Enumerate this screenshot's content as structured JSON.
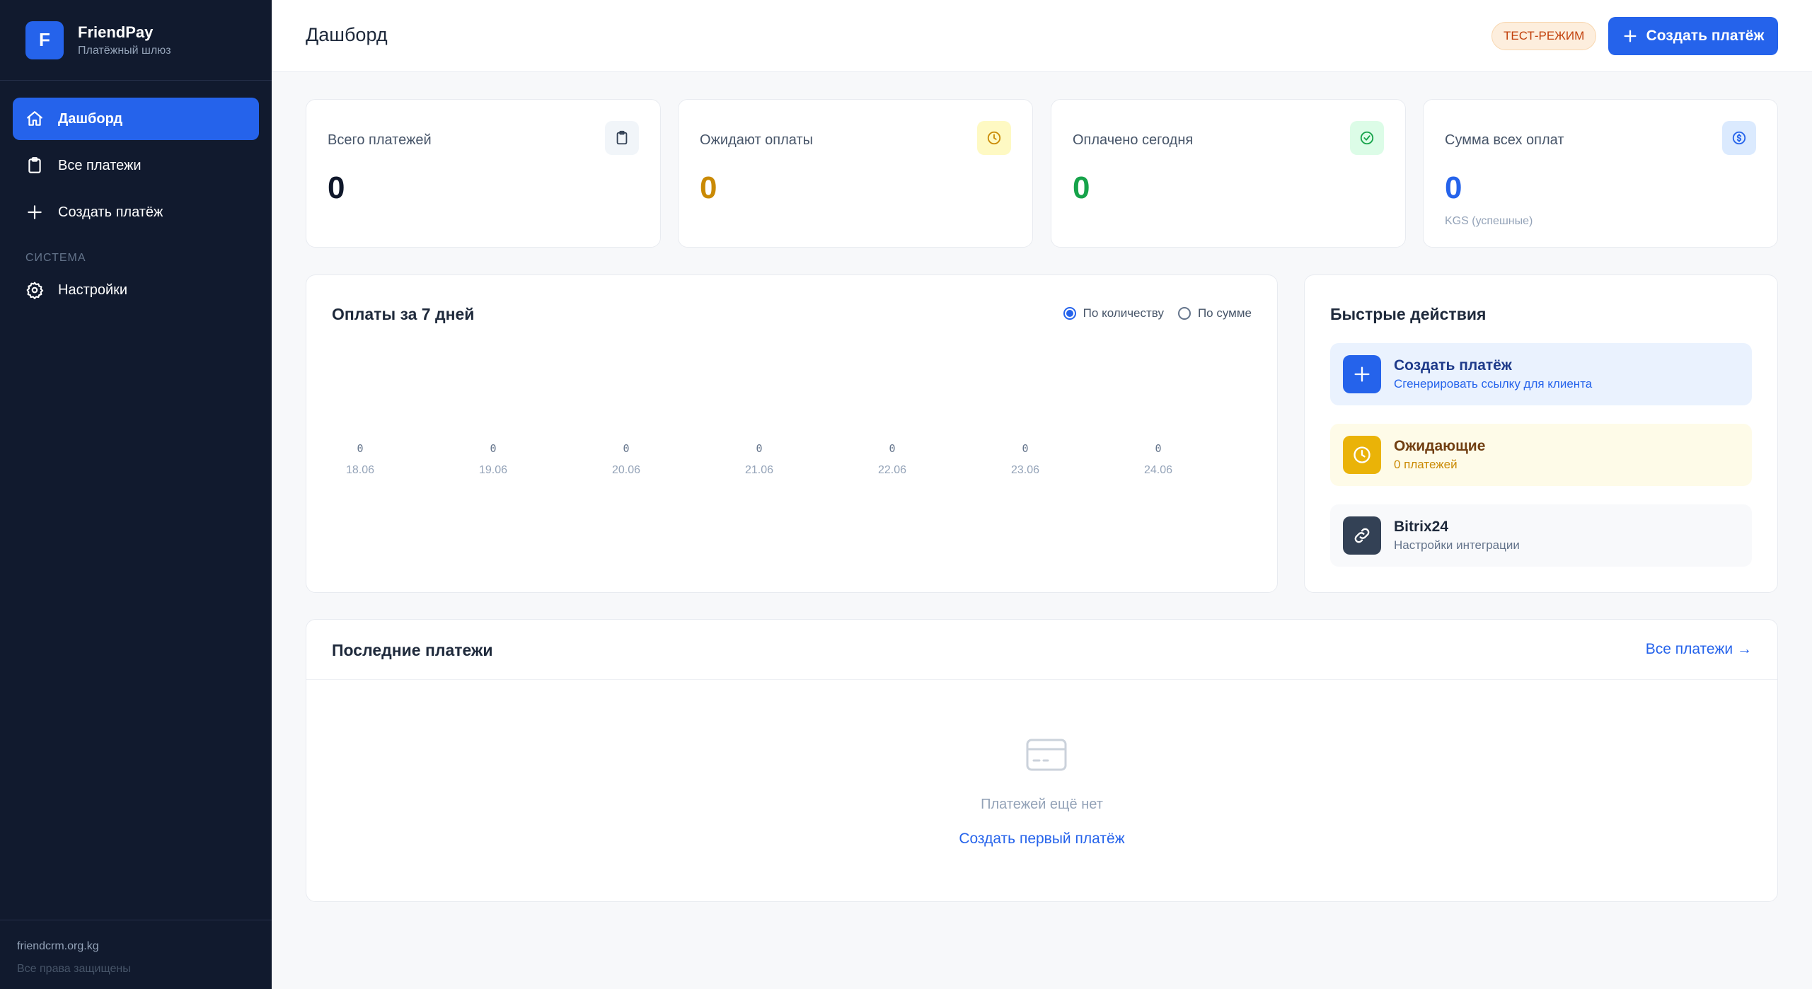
{
  "brand": {
    "logo_letter": "F",
    "name": "FriendPay",
    "subtitle": "Платёжный шлюз"
  },
  "sidebar": {
    "items": [
      {
        "label": "Дашборд",
        "icon": "home-icon",
        "active": true
      },
      {
        "label": "Все платежи",
        "icon": "clipboard-icon"
      },
      {
        "label": "Создать платёж",
        "icon": "plus-icon"
      }
    ],
    "section_label": "СИСТЕМА",
    "system_items": [
      {
        "label": "Настройки",
        "icon": "gear-icon"
      }
    ],
    "footer": {
      "domain": "friendcrm.org.kg",
      "rights": "Все права защищены"
    }
  },
  "header": {
    "title": "Дашборд",
    "badge": "ТЕСТ-РЕЖИМ",
    "create_button": "Создать платёж"
  },
  "stats": [
    {
      "label": "Всего платежей",
      "value": "0",
      "icon": "clipboard-icon",
      "color": "#0f172a",
      "icon_bg": "#f1f5f9"
    },
    {
      "label": "Ожидают оплаты",
      "value": "0",
      "icon": "clock-icon",
      "color": "#ca8a04",
      "icon_bg": "#fef9c3"
    },
    {
      "label": "Оплачено сегодня",
      "value": "0",
      "icon": "check-circle-icon",
      "color": "#16a34a",
      "icon_bg": "#dcfce7"
    },
    {
      "label": "Сумма всех оплат",
      "value": "0",
      "sub": "KGS (успешные)",
      "icon": "dollar-icon",
      "color": "#2563eb",
      "icon_bg": "#dbeafe"
    }
  ],
  "chart": {
    "title": "Оплаты за 7 дней",
    "options": [
      {
        "label": "По количеству",
        "selected": true
      },
      {
        "label": "По сумме",
        "selected": false
      }
    ]
  },
  "chart_data": {
    "type": "bar",
    "categories": [
      "18.06",
      "19.06",
      "20.06",
      "21.06",
      "22.06",
      "23.06",
      "24.06"
    ],
    "values": [
      0,
      0,
      0,
      0,
      0,
      0,
      0
    ],
    "title": "Оплаты за 7 дней",
    "xlabel": "",
    "ylabel": ""
  },
  "quick_actions": {
    "title": "Быстрые действия",
    "items": [
      {
        "title": "Создать платёж",
        "subtitle": "Сгенерировать ссылку для клиента",
        "icon": "plus-icon",
        "bg": "#eaf2fe",
        "icon_bg": "#2563eb",
        "title_color": "#1e3a8a",
        "sub_color": "#2563eb"
      },
      {
        "title": "Ожидающие",
        "subtitle": "0 платежей",
        "icon": "clock-icon",
        "bg": "#fefbe8",
        "icon_bg": "#eab308",
        "title_color": "#713f12",
        "sub_color": "#ca8a04"
      },
      {
        "title": "Bitrix24",
        "subtitle": "Настройки интеграции",
        "icon": "link-icon",
        "bg": "#f8f9fb",
        "icon_bg": "#334155",
        "title_color": "#1e293b",
        "sub_color": "#64748b"
      }
    ]
  },
  "recent": {
    "title": "Последние платежи",
    "all_link": "Все платежи →",
    "empty_icon": "credit-card-icon",
    "empty_text": "Платежей ещё нет",
    "empty_link": "Создать первый платёж"
  }
}
